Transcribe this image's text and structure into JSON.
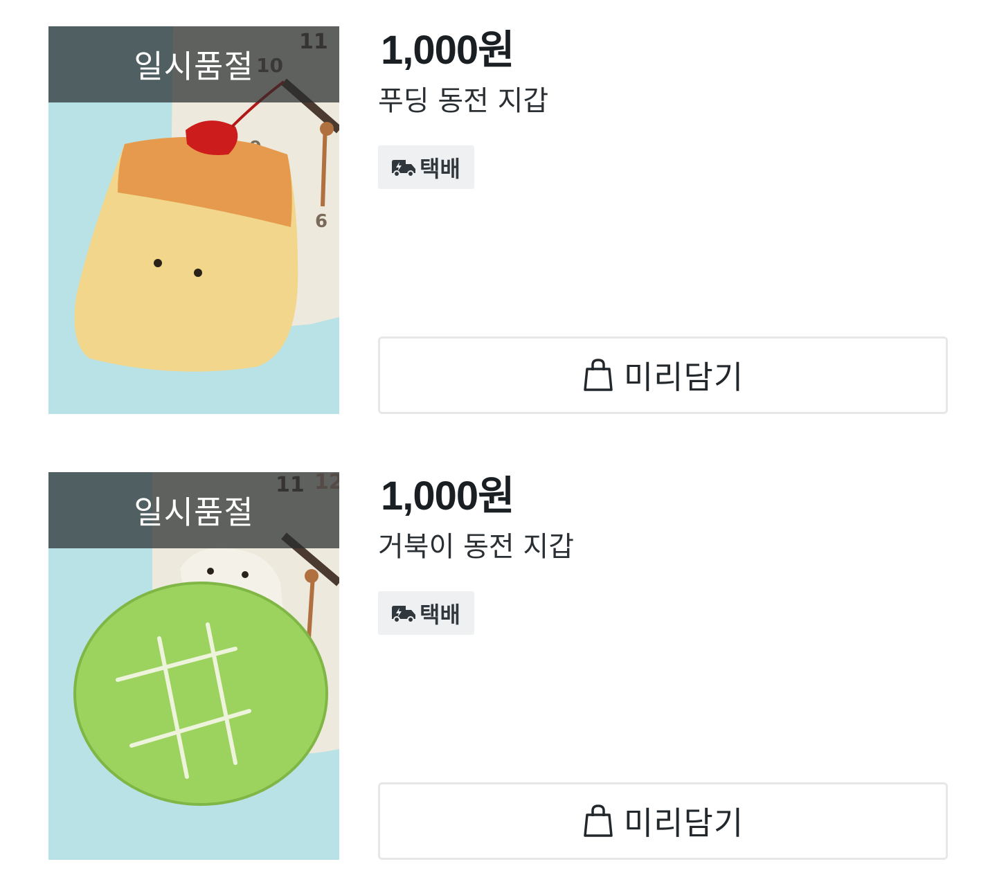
{
  "products": [
    {
      "image_kind": "pudding-coin-purse",
      "soldout_label": "일시품절",
      "price": "1,000원",
      "name": "푸딩 동전 지갑",
      "delivery": {
        "icon": "truck-icon",
        "label": "택배"
      },
      "cart_button": {
        "icon": "shopping-bag-icon",
        "label": "미리담기"
      }
    },
    {
      "image_kind": "turtle-coin-purse",
      "soldout_label": "일시품절",
      "price": "1,000원",
      "name": "거북이 동전 지갑",
      "delivery": {
        "icon": "truck-icon",
        "label": "택배"
      },
      "cart_button": {
        "icon": "shopping-bag-icon",
        "label": "미리담기"
      }
    }
  ],
  "colors": {
    "text_primary": "#1a1f24",
    "badge_bg": "#eef0f2",
    "button_border": "#e5e7e9",
    "soldout_overlay": "rgba(40,44,46,0.72)",
    "photo_bg": "#b9e3e6"
  }
}
